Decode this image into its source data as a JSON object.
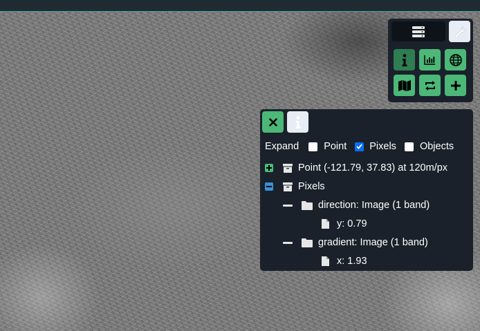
{
  "toolbar": {
    "layers_icon": "layers-icon",
    "wrench_icon": "wrench-icon",
    "buttons": [
      {
        "icon": "info-icon",
        "active": true
      },
      {
        "icon": "chart-icon",
        "active": false
      },
      {
        "icon": "globe-icon",
        "active": false
      },
      {
        "icon": "map-icon",
        "active": false
      },
      {
        "icon": "swap-icon",
        "active": false
      },
      {
        "icon": "plus-icon",
        "active": false
      }
    ]
  },
  "inspector": {
    "close_icon": "close-icon",
    "info_icon": "info-icon",
    "expand_label": "Expand",
    "options": [
      {
        "label": "Point",
        "checked": false
      },
      {
        "label": "Pixels",
        "checked": true
      },
      {
        "label": "Objects",
        "checked": false
      }
    ],
    "tree": {
      "point_label": "Point (-121.79, 37.83) at 120m/px",
      "pixels_label": "Pixels",
      "direction_label": "direction: Image (1 band)",
      "direction_value": "y: 0.79",
      "gradient_label": "gradient: Image (1 band)",
      "gradient_value": "x: 1.93"
    }
  },
  "colors": {
    "panel_bg": "#1a212b",
    "green": "#4cb878",
    "green_active": "#2f7d52",
    "checkbox_blue": "#0b6ff1",
    "tree_blue": "#3a8fd9"
  }
}
